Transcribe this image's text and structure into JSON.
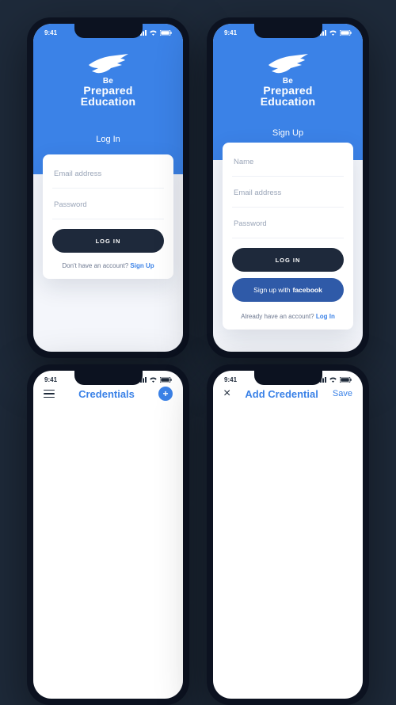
{
  "status": {
    "time": "9:41"
  },
  "brand": {
    "line1": "Be",
    "line2": "Prepared",
    "line3": "Education"
  },
  "login": {
    "title": "Log In",
    "email_placeholder": "Email address",
    "password_placeholder": "Password",
    "submit": "LOG IN",
    "prompt_text": "Don't have an account? ",
    "prompt_link": "Sign Up"
  },
  "signup": {
    "title": "Sign Up",
    "name_placeholder": "Name",
    "email_placeholder": "Email address",
    "password_placeholder": "Password",
    "submit": "LOG IN",
    "fb_prefix": "Sign up with ",
    "fb_brand": "facebook",
    "prompt_text": "Already have an account? ",
    "prompt_link": "Log In"
  },
  "partial_left": {
    "title": "Credentials"
  },
  "partial_right": {
    "title": "Add Credential",
    "save": "Save"
  },
  "colors": {
    "blue": "#3b82e7",
    "dark": "#1e293b",
    "fb": "#2f5aa8",
    "bg": "#1e2a3a"
  }
}
